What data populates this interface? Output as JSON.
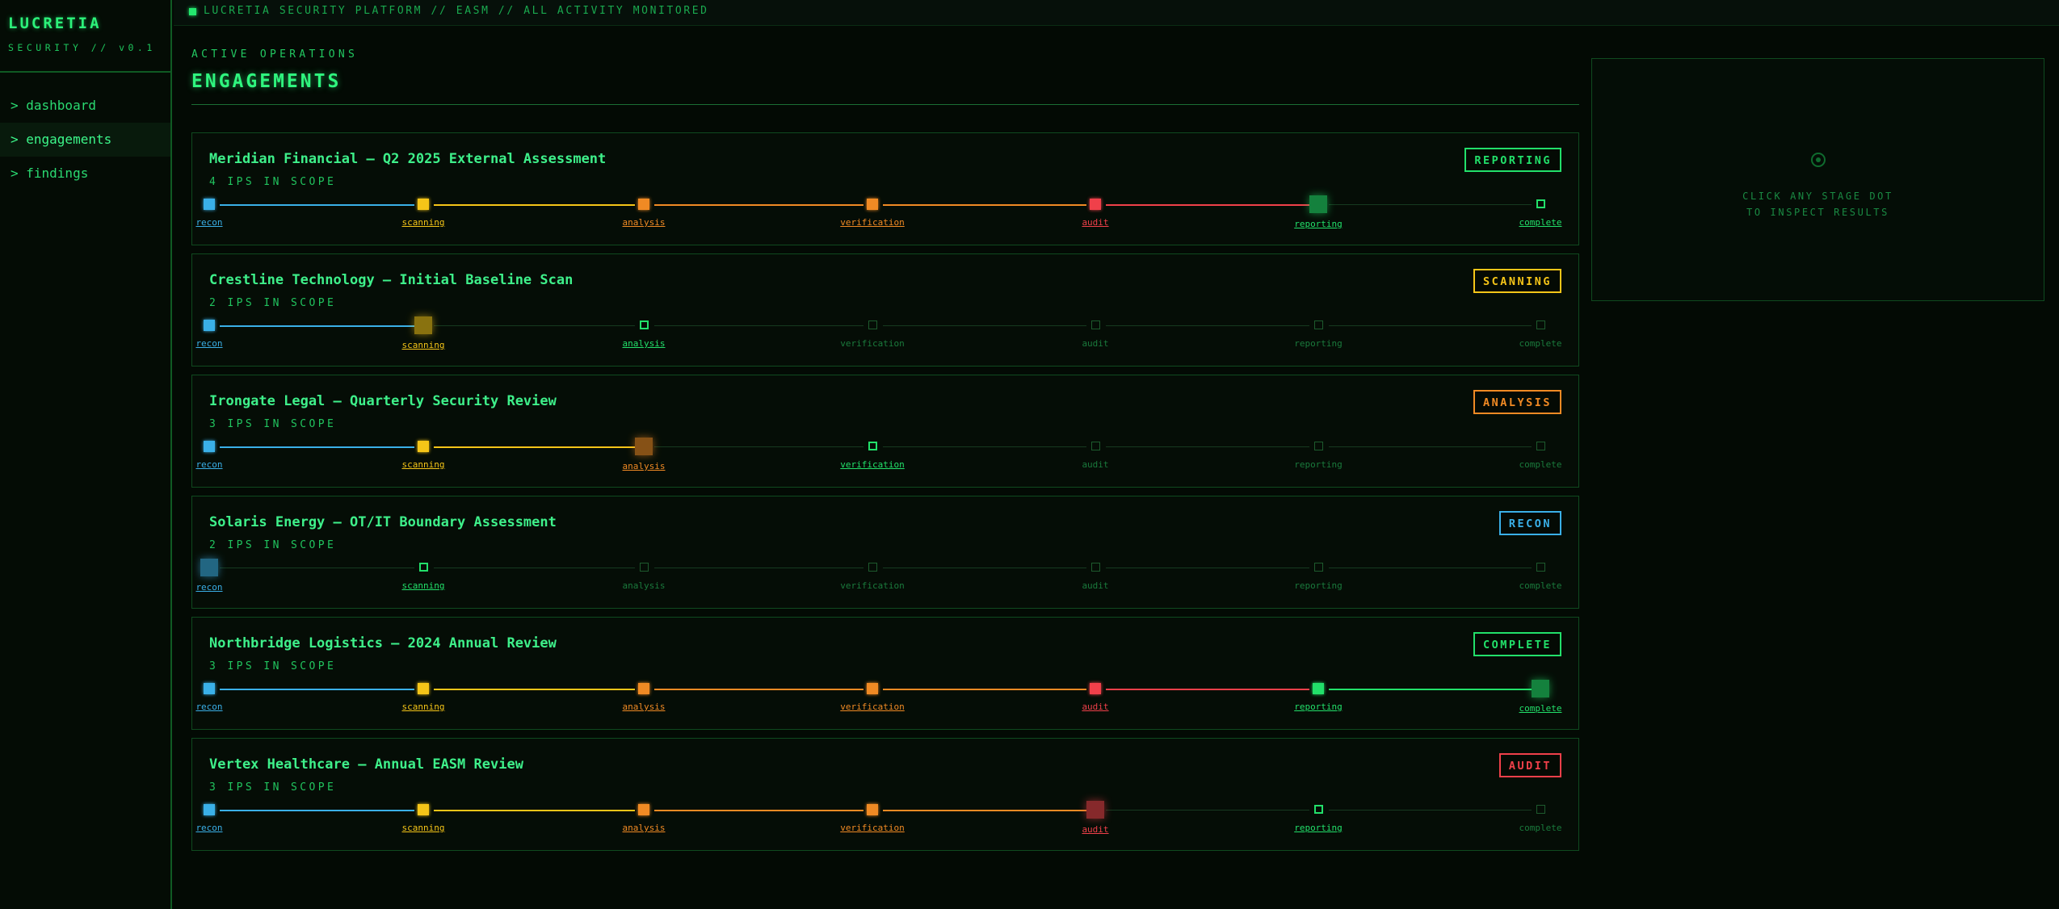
{
  "brand": {
    "title": "LUCRETIA",
    "subtitle": "SECURITY // v0.1"
  },
  "nav": [
    {
      "label": "> dashboard",
      "active": false
    },
    {
      "label": "> engagements",
      "active": true
    },
    {
      "label": "> findings",
      "active": false
    }
  ],
  "topbar": {
    "text": "LUCRETIA SECURITY PLATFORM // EASM // ALL ACTIVITY MONITORED"
  },
  "main": {
    "section_label": "ACTIVE OPERATIONS",
    "title": "ENGAGEMENTS"
  },
  "stage_colors": {
    "recon": "#3ab0e8",
    "scanning": "#f5c518",
    "analysis": "#f08a24",
    "verification": "#f08a24",
    "audit": "#f0404a",
    "reporting": "#22e06a",
    "complete": "#22e06a"
  },
  "stages": [
    "recon",
    "scanning",
    "analysis",
    "verification",
    "audit",
    "reporting",
    "complete"
  ],
  "engagements": [
    {
      "title": "Meridian Financial — Q2 2025 External Assessment",
      "scope": "4 IPS IN SCOPE",
      "status": "REPORTING",
      "status_color": "#22e06a",
      "current_stage": 5
    },
    {
      "title": "Crestline Technology — Initial Baseline Scan",
      "scope": "2 IPS IN SCOPE",
      "status": "SCANNING",
      "status_color": "#f5c518",
      "current_stage": 1
    },
    {
      "title": "Irongate Legal — Quarterly Security Review",
      "scope": "3 IPS IN SCOPE",
      "status": "ANALYSIS",
      "status_color": "#f08a24",
      "current_stage": 2
    },
    {
      "title": "Solaris Energy — OT/IT Boundary Assessment",
      "scope": "2 IPS IN SCOPE",
      "status": "RECON",
      "status_color": "#3ab0e8",
      "current_stage": 0
    },
    {
      "title": "Northbridge Logistics — 2024 Annual Review",
      "scope": "3 IPS IN SCOPE",
      "status": "COMPLETE",
      "status_color": "#22e06a",
      "current_stage": 6
    },
    {
      "title": "Vertex Healthcare — Annual EASM Review",
      "scope": "3 IPS IN SCOPE",
      "status": "AUDIT",
      "status_color": "#f0404a",
      "current_stage": 4
    }
  ],
  "panel": {
    "line1": "CLICK ANY STAGE DOT",
    "line2": "TO INSPECT RESULTS"
  }
}
